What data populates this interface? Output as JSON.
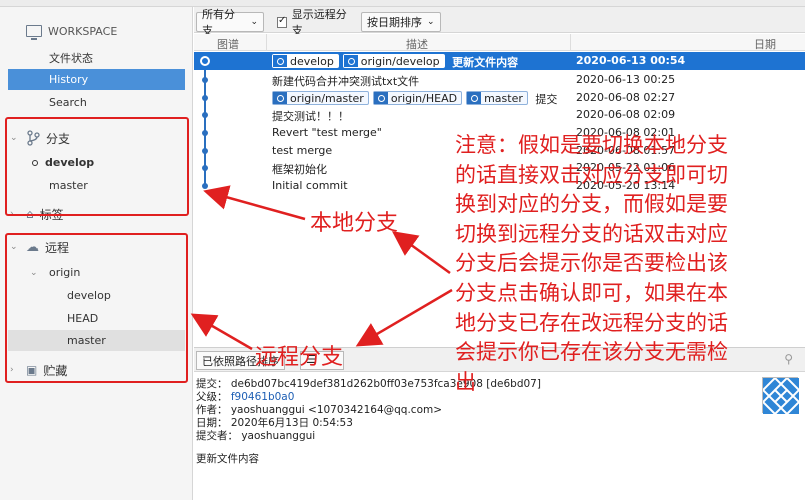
{
  "sidebar": {
    "workspace_label": "WORKSPACE",
    "items": [
      {
        "label": "文件状态"
      },
      {
        "label": "History"
      },
      {
        "label": "Search"
      }
    ],
    "branches_section": "分支",
    "branches": [
      "develop",
      "master"
    ],
    "tags_section": "标签",
    "remotes_section": "远程",
    "remote_name": "origin",
    "remote_branches": [
      "develop",
      "HEAD",
      "master"
    ],
    "stash_section": "贮藏"
  },
  "toolbar": {
    "branch_select": "所有分支",
    "show_remote_label": "显示远程分支",
    "sort_select": "按日期排序"
  },
  "columns": {
    "graph": "图谱",
    "description": "描述",
    "date": "日期"
  },
  "commits": [
    {
      "tags": [
        "develop",
        "origin/develop"
      ],
      "message": "更新文件内容",
      "date": "2020-06-13 00:54"
    },
    {
      "tags": [],
      "message": "新建代码合并冲突测试txt文件",
      "date": "2020-06-13 00:25"
    },
    {
      "tags": [
        "origin/master",
        "origin/HEAD",
        "master"
      ],
      "message": "提交",
      "date": "2020-06-08 02:27"
    },
    {
      "tags": [],
      "message": "提交测试！！！",
      "date": "2020-06-08 02:09"
    },
    {
      "tags": [],
      "message": "Revert \"test merge\"",
      "date": "2020-06-08 02:01"
    },
    {
      "tags": [],
      "message": "test merge",
      "date": "2020-06-08 01:57"
    },
    {
      "tags": [],
      "message": "框架初始化",
      "date": "2020-05-22 01:06"
    },
    {
      "tags": [],
      "message": "Initial commit",
      "date": "2020-05-20 13:14"
    }
  ],
  "lower": {
    "sort_button": "已依照路径排序",
    "detail": {
      "commit_label": "提交：",
      "commit_value": "de6bd07bc419def381d262b0ff03e753fca3e908 [de6bd07]",
      "parent_label": "父级：",
      "parent_value": "f90461b0a0",
      "author_label": "作者：",
      "author_value": "yaoshuanggui <1070342164@qq.com>",
      "date_label": "日期：",
      "date_value": "2020年6月13日 0:54:53",
      "committer_label": "提交者：",
      "committer_value": "yaoshuanggui",
      "message": "更新文件内容"
    }
  },
  "annotations": {
    "main": "注意：假如是要切换本地分支的话直接双击对应分支即可切换到对应的分支，而假如是要切换到远程分支的话双击对应分支后会提示你是否要检出该分支点击确认即可，如果在本地分支已存在改远程分支的话会提示你已存在该分支无需检出",
    "local": "本地分支",
    "remote": "远程分支"
  }
}
